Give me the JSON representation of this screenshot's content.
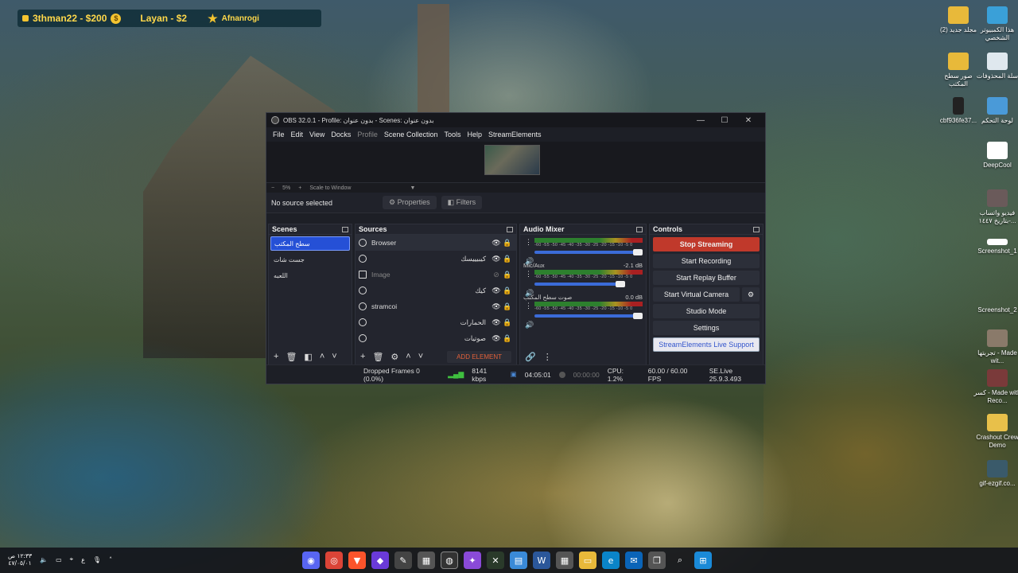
{
  "overlay": {
    "donor1": "3thman22 - $200",
    "donor2": "Layan - $2",
    "donor3": "Afnanrogi",
    "coin_symbol": "$"
  },
  "desktop": {
    "icons": [
      {
        "label": "(2) مجلد جديد",
        "icon": "folder-icon"
      },
      {
        "label": "هذا الكمبيوتر الشخصي",
        "icon": "computer-icon"
      },
      {
        "label": "صور سطح المكتب",
        "icon": "folder-pictures-icon"
      },
      {
        "label": "سلة المحذوفات",
        "icon": "recycle-bin-icon"
      },
      {
        "label": "cbf936fe37...",
        "icon": "phone-file-icon"
      },
      {
        "label": "لوحة التحكم",
        "icon": "control-panel-icon"
      },
      {
        "label": "DeepCool",
        "icon": "deepcool-icon"
      },
      {
        "label": "فيديو واتساب بتاريخ ١٤٤٧-...",
        "icon": "video-file-icon"
      },
      {
        "label": "Screenshot_1",
        "icon": "image-file-icon"
      },
      {
        "label": "Screenshot_2",
        "icon": "image-file-icon"
      },
      {
        "label": "تجربتها - Made wit...",
        "icon": "video-file-icon"
      },
      {
        "label": "كسر - Made with Reco...",
        "icon": "video-file-icon"
      },
      {
        "label": "Crashout Crew Demo",
        "icon": "game-icon"
      },
      {
        "label": "gif-ezgif.co...",
        "icon": "gif-file-icon"
      }
    ]
  },
  "obs": {
    "title": "OBS 32.0.1 - Profile: بدون عنوان - Scenes: بدون عنوان",
    "window_controls": {
      "minimize": "—",
      "maximize": "☐",
      "close": "✕"
    },
    "menu": [
      "File",
      "Edit",
      "View",
      "Docks",
      "Profile",
      "Scene Collection",
      "Tools",
      "Help",
      "StreamElements"
    ],
    "zoom": {
      "minus": "−",
      "percent": "5%",
      "plus": "+",
      "mode": "Scale to Window",
      "dropdown": "▼"
    },
    "source_bar": {
      "no_source": "No source selected",
      "properties": "Properties",
      "filters": "Filters"
    },
    "scenes": {
      "title": "Scenes",
      "items": [
        "سطح المكتب",
        "جست شات",
        "اللعبه"
      ],
      "selected_index": 0
    },
    "sources": {
      "title": "Sources",
      "items": [
        {
          "name": "Browser",
          "rtl": false,
          "type": "browser",
          "visible": true
        },
        {
          "name": "كيبيييسك",
          "rtl": true,
          "type": "browser",
          "visible": true
        },
        {
          "name": "Image",
          "rtl": false,
          "type": "image",
          "visible": false
        },
        {
          "name": "كيك",
          "rtl": true,
          "type": "browser",
          "visible": true
        },
        {
          "name": "stramcoi",
          "rtl": false,
          "type": "browser",
          "visible": true
        },
        {
          "name": "الحمارات",
          "rtl": true,
          "type": "browser",
          "visible": true
        },
        {
          "name": "صوتيات",
          "rtl": true,
          "type": "browser",
          "visible": true
        }
      ],
      "add_element": "ADD ELEMENT"
    },
    "mixer": {
      "title": "Audio Mixer",
      "scale": "-60 -55 -50 -45 -40 -35 -30 -25 -20 -15 -10 -5 0",
      "channels": [
        {
          "name": "",
          "db": ""
        },
        {
          "name": "Mic/Aux",
          "db": "-2.1 dB"
        },
        {
          "name": "صوت سطح المكتب",
          "db": "0.0 dB"
        }
      ]
    },
    "controls": {
      "title": "Controls",
      "stop_streaming": "Stop Streaming",
      "start_recording": "Start Recording",
      "start_replay": "Start Replay Buffer",
      "start_vcam": "Start Virtual Camera",
      "studio_mode": "Studio Mode",
      "settings": "Settings",
      "se_support": "StreamElements Live Support"
    },
    "status": {
      "dropped": "Dropped Frames 0 (0.0%)",
      "kbps": "8141 kbps",
      "stream_time": "04:05:01",
      "rec_time": "00:00:00",
      "cpu": "CPU: 1.2%",
      "fps": "60.00 / 60.00 FPS",
      "se": "SE.Live 25.9.3.493"
    }
  },
  "taskbar": {
    "clock_time": "١٢:٣٣ ص",
    "clock_date": "٤٧/٠٥/٠١",
    "lang": "ع"
  }
}
